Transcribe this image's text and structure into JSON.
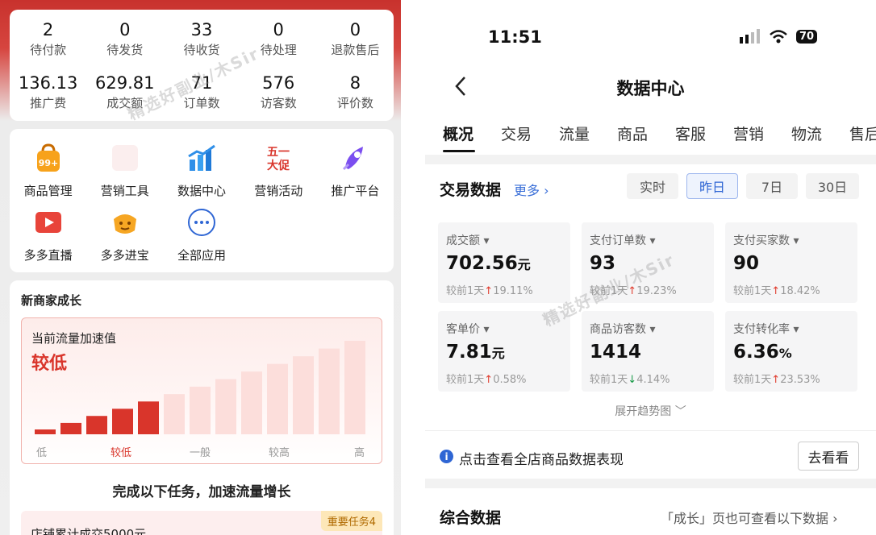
{
  "left": {
    "stats_row1": [
      {
        "value": "2",
        "label": "待付款"
      },
      {
        "value": "0",
        "label": "待发货"
      },
      {
        "value": "33",
        "label": "待收货"
      },
      {
        "value": "0",
        "label": "待处理"
      },
      {
        "value": "0",
        "label": "退款售后"
      }
    ],
    "stats_row2": [
      {
        "value": "136.13",
        "label": "推广费"
      },
      {
        "value": "629.81",
        "label": "成交额"
      },
      {
        "value": "71",
        "label": "订单数"
      },
      {
        "value": "576",
        "label": "访客数"
      },
      {
        "value": "8",
        "label": "评价数"
      }
    ],
    "tools_row1": [
      {
        "label": "商品管理",
        "icon": "product-bag-icon"
      },
      {
        "label": "营销工具",
        "icon": "marketing-tools-icon"
      },
      {
        "label": "数据中心",
        "icon": "data-center-icon"
      },
      {
        "label": "营销活动",
        "icon": "promo-event-icon"
      },
      {
        "label": "推广平台",
        "icon": "rocket-icon"
      }
    ],
    "tools_row2": [
      {
        "label": "多多直播",
        "icon": "live-stream-icon"
      },
      {
        "label": "多多进宝",
        "icon": "treasure-icon"
      },
      {
        "label": "全部应用",
        "icon": "more-apps-icon"
      }
    ],
    "badge_99": "99+",
    "promo_icon_line1": "五一",
    "promo_icon_line2": "大促",
    "growth": {
      "title": "新商家成长",
      "accel_label": "当前流量加速值",
      "accel_value": "较低",
      "level_fraction": 0.3,
      "axis": [
        "低",
        "较低",
        "一般",
        "较高",
        "高"
      ],
      "hint": "完成以下任务，加速流量增长",
      "task_title": "店铺累计成交5000元",
      "task_badge": "重要任务4"
    }
  },
  "right": {
    "time": "11:51",
    "battery": "70",
    "page_title": "数据中心",
    "tabs": [
      "概况",
      "交易",
      "流量",
      "商品",
      "客服",
      "营销",
      "物流",
      "售后"
    ],
    "trade": {
      "title": "交易数据",
      "more": "更多 ›",
      "ranges": [
        "实时",
        "昨日",
        "7日",
        "30日"
      ],
      "active_range": "昨日",
      "metrics": [
        {
          "label": "成交额",
          "value": "702.56",
          "unit": "元",
          "cmp_prefix": "较前1天",
          "arrow": "↑",
          "dir": "up",
          "cmp": "19.11%"
        },
        {
          "label": "支付订单数",
          "value": "93",
          "unit": "",
          "cmp_prefix": "较前1天",
          "arrow": "↑",
          "dir": "up",
          "cmp": "19.23%"
        },
        {
          "label": "支付买家数",
          "value": "90",
          "unit": "",
          "cmp_prefix": "较前1天",
          "arrow": "↑",
          "dir": "up",
          "cmp": "18.42%"
        },
        {
          "label": "客单价",
          "value": "7.81",
          "unit": "元",
          "cmp_prefix": "较前1天",
          "arrow": "↑",
          "dir": "up",
          "cmp": "0.58%"
        },
        {
          "label": "商品访客数",
          "value": "1414",
          "unit": "",
          "cmp_prefix": "较前1天",
          "arrow": "↓",
          "dir": "down",
          "cmp": "4.14%"
        },
        {
          "label": "支付转化率",
          "value": "6.36",
          "unit": "%",
          "cmp_prefix": "较前1天",
          "arrow": "↑",
          "dir": "up",
          "cmp": "23.53%"
        }
      ],
      "expand": "展开趋势图 ﹀",
      "info": "点击查看全店商品数据表现",
      "info_icon": "i",
      "goto": "去看看"
    },
    "summary": {
      "title": "综合数据",
      "note": "「成长」页也可查看以下数据 ›"
    }
  },
  "watermark": "精选好副业/木Sir",
  "colors": {
    "brand_red": "#d9352b",
    "link_blue": "#2f66d4",
    "up": "#e03b2d",
    "down": "#1a9b49"
  }
}
